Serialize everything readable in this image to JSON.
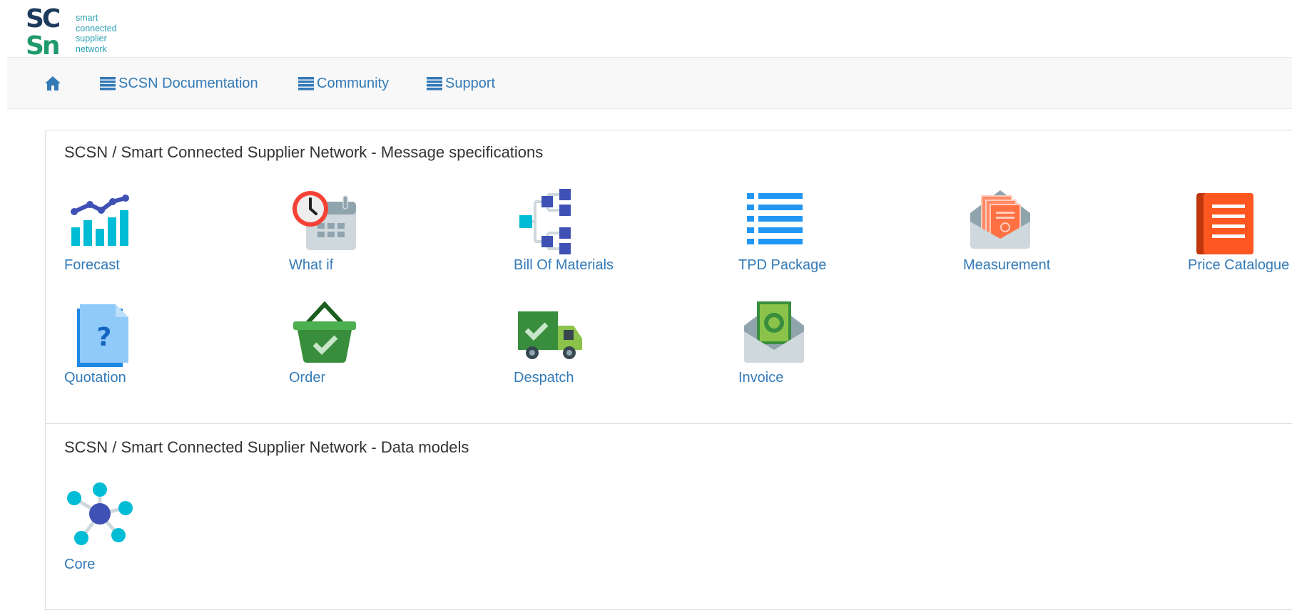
{
  "logo": {
    "text_lines": [
      "smart",
      "connected",
      "supplier",
      "network"
    ],
    "colors": {
      "dark": "#1d3a5c",
      "green": "#1f9a6a",
      "text": "#2a9fb3"
    }
  },
  "nav": {
    "home_icon": "home-icon",
    "items": [
      {
        "label": "SCSN Documentation",
        "icon": "list-icon"
      },
      {
        "label": "Community",
        "icon": "list-icon"
      },
      {
        "label": "Support",
        "icon": "list-icon"
      }
    ]
  },
  "sections": {
    "message_specs": {
      "title": "SCSN / Smart Connected Supplier Network - Message specifications",
      "tiles": [
        {
          "label": "Forecast",
          "icon": "forecast-chart-icon"
        },
        {
          "label": "What if",
          "icon": "clock-calendar-icon"
        },
        {
          "label": "Bill Of Materials",
          "icon": "tree-structure-icon"
        },
        {
          "label": "TPD Package",
          "icon": "list-icon"
        },
        {
          "label": "Measurement",
          "icon": "certificate-envelope-icon"
        },
        {
          "label": "Price Catalogue",
          "icon": "document-icon"
        },
        {
          "label": "Quotation",
          "icon": "question-document-icon"
        },
        {
          "label": "Order",
          "icon": "basket-check-icon"
        },
        {
          "label": "Despatch",
          "icon": "delivery-truck-icon"
        },
        {
          "label": "Invoice",
          "icon": "money-envelope-icon"
        }
      ]
    },
    "data_models": {
      "title": "SCSN / Smart Connected Supplier Network - Data models",
      "tiles": [
        {
          "label": "Core",
          "icon": "network-nodes-icon"
        }
      ]
    }
  },
  "colors": {
    "link": "#337ab7",
    "navbar_bg": "#f8f8f8",
    "border": "#dddddd"
  }
}
